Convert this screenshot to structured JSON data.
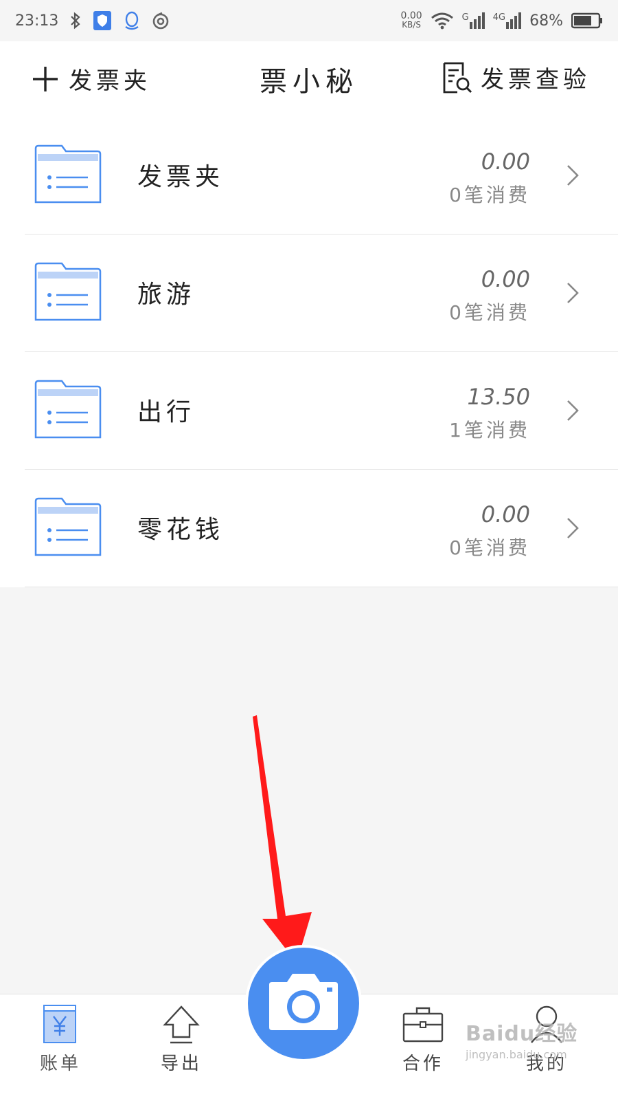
{
  "status_bar": {
    "time": "23:13",
    "net_speed_value": "0.00",
    "net_speed_unit": "KB/S",
    "signal_1_label": "G",
    "signal_2_label": "4G",
    "battery": "68%"
  },
  "header": {
    "add_label": "发票夹",
    "title": "票小秘",
    "verify_label": "发票查验"
  },
  "folders": [
    {
      "name": "发票夹",
      "amount": "0.00",
      "count": "0笔消费"
    },
    {
      "name": "旅游",
      "amount": "0.00",
      "count": "0笔消费"
    },
    {
      "name": "出行",
      "amount": "13.50",
      "count": "1笔消费"
    },
    {
      "name": "零花钱",
      "amount": "0.00",
      "count": "0笔消费"
    }
  ],
  "bottom_nav": {
    "bills": "账单",
    "export": "导出",
    "cooperate": "合作",
    "mine": "我的"
  },
  "watermark": {
    "logo": "Baidu经验",
    "url": "jingyan.baidu.com"
  },
  "colors": {
    "accent": "#4a8ef0",
    "arrow": "#ff1a1a",
    "folder_stroke": "#4a8ef0",
    "folder_tab": "#bcd3f7"
  }
}
